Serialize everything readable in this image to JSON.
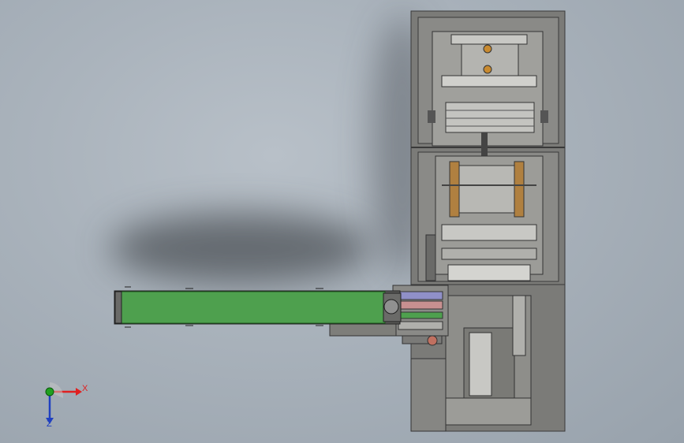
{
  "colors": {
    "background": "#aab3bc",
    "machine_frame": "#7a7a78",
    "machine_panel": "#8c8c88",
    "conveyor_belt": "#4ea04e",
    "axis_x": "#e02020",
    "axis_y": "#20a020",
    "axis_z": "#2040c0"
  },
  "triad": {
    "x_label": "X",
    "z_label": "Z",
    "origin_icon": "coordinate-triad-icon"
  }
}
